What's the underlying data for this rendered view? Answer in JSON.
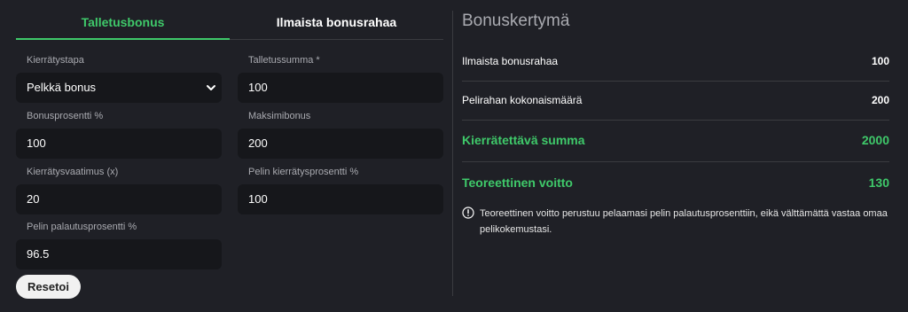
{
  "tabs": [
    "Talletusbonus",
    "Ilmaista bonusrahaa"
  ],
  "left_col": [
    {
      "label": "Kierrätystapa",
      "value": "Pelkkä bonus",
      "type": "select"
    },
    {
      "label": "Bonusprosentti %",
      "value": "100"
    },
    {
      "label": "Kierrätysvaatimus (x)",
      "value": "20"
    },
    {
      "label": "Pelin palautusprosentti %",
      "value": "96.5"
    }
  ],
  "right_col": [
    {
      "label": "Talletussumma *",
      "value": "100"
    },
    {
      "label": "Maksimibonus",
      "value": "200"
    },
    {
      "label": "Pelin kierrätysprosentti %",
      "value": "100"
    }
  ],
  "reset_label": "Resetoi",
  "summary": {
    "title": "Bonuskertymä",
    "rows": [
      {
        "key": "Ilmaista bonusrahaa",
        "value": "100"
      },
      {
        "key": "Pelirahan kokonaismäärä",
        "value": "200"
      },
      {
        "key": "Kierrätettävä summa",
        "value": "2000"
      },
      {
        "key": "Teoreettinen voitto",
        "value": "130"
      }
    ],
    "note": "Teoreettinen voitto perustuu pelaamasi pelin palautusprosenttiin, eikä välttämättä vastaa omaa pelikokemustasi."
  },
  "colors": {
    "accent": "#3fc96a",
    "background": "#1f2026",
    "input_bg": "#16171b"
  },
  "icons": {
    "select": "chevron-down-icon",
    "note": "info-icon"
  }
}
